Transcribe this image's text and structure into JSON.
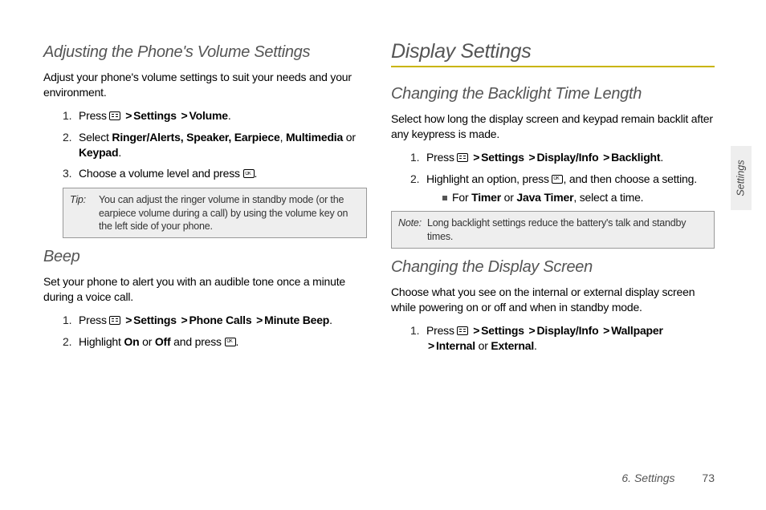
{
  "left": {
    "subheading1": "Adjusting the Phone's Volume Settings",
    "para1": "Adjust your phone's volume settings to suit your needs and your environment.",
    "steps1": {
      "s1_pre": "Press ",
      "s1_path": [
        "Settings",
        "Volume"
      ],
      "s1_post": ".",
      "s2_pre": "Select ",
      "s2_b1": "Ringer/Alerts, Speaker, Earpiece",
      "s2_mid1": ", ",
      "s2_b2": "Multimedia",
      "s2_mid2": " or ",
      "s2_b3": "Keypad",
      "s2_post": ".",
      "s3_pre": "Choose a volume level and press ",
      "s3_post": "."
    },
    "tip_label": "Tip:",
    "tip_body": "You can adjust the ringer volume in standby mode (or the earpiece volume during a call) by using the volume key on the left side of your phone.",
    "subheading2": "Beep",
    "para2": "Set your phone to alert you with an audible tone once a minute during a voice call.",
    "steps2": {
      "s1_pre": "Press ",
      "s1_path": [
        "Settings",
        "Phone Calls",
        "Minute Beep"
      ],
      "s1_post": ".",
      "s2_pre": "Highlight ",
      "s2_b1": "On",
      "s2_mid": " or ",
      "s2_b2": "Off",
      "s2_mid2": " and press ",
      "s2_post": "."
    }
  },
  "right": {
    "main_heading": "Display Settings",
    "subheading1": "Changing the Backlight Time Length",
    "para1": "Select how long the display screen and keypad remain backlit after any keypress is made.",
    "steps1": {
      "s1_pre": "Press ",
      "s1_path": [
        "Settings",
        "Display/Info",
        "Backlight"
      ],
      "s1_post": ".",
      "s2_pre": "Highlight an option, press ",
      "s2_post": ", and then choose a setting."
    },
    "sub_bullet_pre": "For ",
    "sub_bullet_b1": "Timer",
    "sub_bullet_mid": " or ",
    "sub_bullet_b2": "Java Timer",
    "sub_bullet_post": ", select a time.",
    "note_label": "Note:",
    "note_body": "Long backlight settings reduce the battery's talk and standby times.",
    "subheading2": "Changing the Display Screen",
    "para2": "Choose what you see on the internal or external display screen while powering on or off and when in standby mode.",
    "steps2": {
      "s1_pre": "Press ",
      "s1_path": [
        "Settings",
        "Display/Info",
        "Wallpaper"
      ],
      "s1_last_b1": "Internal",
      "s1_last_mid": " or ",
      "s1_last_b2": "External",
      "s1_post": "."
    }
  },
  "side_tab": "Settings",
  "footer_chapter": "6. Settings",
  "footer_page": "73",
  "gt": ">"
}
